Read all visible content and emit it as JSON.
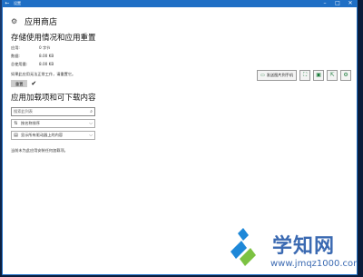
{
  "window": {
    "title": "设置",
    "back_glyph": "←",
    "controls": {
      "minimize": "–",
      "maximize": "□",
      "close": "✕"
    }
  },
  "app": {
    "name": "应用商店",
    "icon": "gear-icon",
    "icon_glyph": "⚙"
  },
  "storage": {
    "title": "存储使用情况和应用重置",
    "rows": [
      {
        "key": "应用:",
        "value": "0 字节"
      },
      {
        "key": "数据:",
        "value": "8.00 KB"
      },
      {
        "key": "总使用量:",
        "value": "8.00 KB"
      }
    ],
    "note": "如果此应用无法正常工作，请重置它。",
    "reset_label": "重置",
    "check_glyph": "✔"
  },
  "addons": {
    "title": "应用加载项和可下载内容",
    "search_placeholder": "搜索此列表",
    "search_icon": "⌕",
    "sort_label": "按名称排序",
    "sort_icon": "⇅",
    "filter_label": "显示所有驱动器上的内容",
    "filter_icon": "▤",
    "chevron_glyph": "⌵",
    "empty_message": "当前未为此应用安装任何加载项。"
  },
  "toolbar": {
    "send_label": "发送图片到手机",
    "send_icon": "▭",
    "tools": [
      {
        "name": "fullscreen-icon",
        "glyph": "⛶"
      },
      {
        "name": "save-icon",
        "glyph": "▣"
      },
      {
        "name": "share-icon",
        "glyph": "⇱"
      },
      {
        "name": "settings-icon",
        "glyph": "⚙"
      }
    ]
  },
  "watermark": {
    "brand": "学知网",
    "url": "www.jmqz1000.com"
  },
  "colors": {
    "titlebar": "#1f6fc5",
    "desktop": "#0b1c3a",
    "watermark": "#3b6ab2",
    "accent_green": "#1a7a3a"
  }
}
